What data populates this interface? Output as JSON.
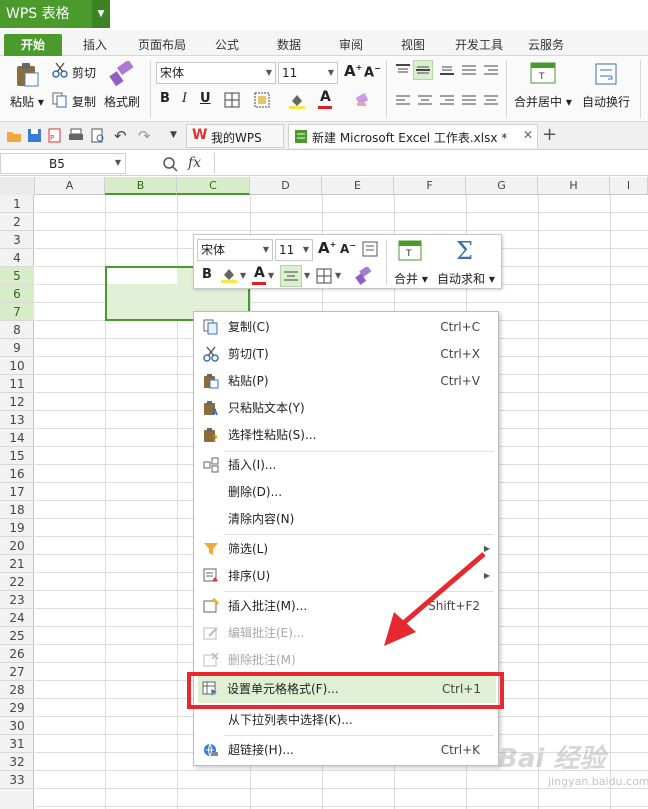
{
  "app": {
    "title": "WPS 表格"
  },
  "menu_tabs": [
    "开始",
    "插入",
    "页面布局",
    "公式",
    "数据",
    "审阅",
    "视图",
    "开发工具",
    "云服务"
  ],
  "ribbon": {
    "paste": "粘贴",
    "cut": "剪切",
    "copy": "复制",
    "format_painter": "格式刷",
    "font_name": "宋体",
    "font_size": "11",
    "merge_center": "合并居中",
    "wrap_text": "自动换行"
  },
  "doc_tabs": {
    "wps_tab": "我的WPS",
    "file_tab": "新建 Microsoft Excel 工作表.xlsx *",
    "add": "+"
  },
  "formula_bar": {
    "name_box": "B5",
    "fx": "fx"
  },
  "columns": [
    "A",
    "B",
    "C",
    "D",
    "E",
    "F",
    "G",
    "H",
    "I"
  ],
  "rows": [
    "1",
    "2",
    "3",
    "4",
    "5",
    "6",
    "7",
    "8",
    "9",
    "10",
    "11",
    "12",
    "13",
    "14",
    "15",
    "16",
    "17",
    "18",
    "19",
    "20",
    "21",
    "22",
    "23",
    "24",
    "25",
    "26",
    "27",
    "28",
    "29",
    "30",
    "31",
    "32",
    "33"
  ],
  "mini_toolbar": {
    "font_name": "宋体",
    "font_size": "11",
    "bold": "B",
    "merge": "合并",
    "autosum": "自动求和"
  },
  "context_menu": {
    "items": [
      {
        "label": "复制(C)",
        "shortcut": "Ctrl+C",
        "icon": "copy-icon"
      },
      {
        "label": "剪切(T)",
        "shortcut": "Ctrl+X",
        "icon": "scissors-icon"
      },
      {
        "label": "粘贴(P)",
        "shortcut": "Ctrl+V",
        "icon": "paste-icon"
      },
      {
        "label": "只粘贴文本(Y)",
        "shortcut": "",
        "icon": "paste-text-icon"
      },
      {
        "label": "选择性粘贴(S)...",
        "shortcut": "",
        "icon": "paste-special-icon"
      },
      {
        "label": "插入(I)...",
        "shortcut": "",
        "icon": "insert-icon"
      },
      {
        "label": "删除(D)...",
        "shortcut": "",
        "icon": ""
      },
      {
        "label": "清除内容(N)",
        "shortcut": "",
        "icon": ""
      },
      {
        "label": "筛选(L)",
        "shortcut": "",
        "icon": "filter-icon"
      },
      {
        "label": "排序(U)",
        "shortcut": "",
        "icon": "sort-icon"
      },
      {
        "label": "插入批注(M)...",
        "shortcut": "Shift+F2",
        "icon": "comment-add-icon"
      },
      {
        "label": "编辑批注(E)...",
        "shortcut": "",
        "icon": "comment-edit-icon"
      },
      {
        "label": "删除批注(M)",
        "shortcut": "",
        "icon": "comment-delete-icon"
      },
      {
        "label": "设置单元格格式(F)...",
        "shortcut": "Ctrl+1",
        "icon": "format-cells-icon"
      },
      {
        "label": "从下拉列表中选择(K)...",
        "shortcut": "",
        "icon": ""
      },
      {
        "label": "超链接(H)...",
        "shortcut": "Ctrl+K",
        "icon": "hyperlink-icon"
      }
    ]
  },
  "colors": {
    "accent": "#4a9a2c",
    "highlight": "#e8282f",
    "selection_fill": "#e1f0d6"
  },
  "watermark": {
    "logo": "Bai 经验",
    "url": "jingyan.baidu.com"
  }
}
